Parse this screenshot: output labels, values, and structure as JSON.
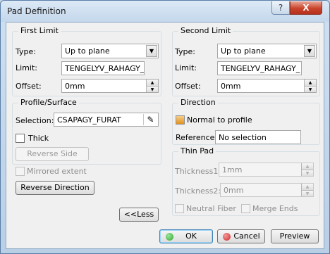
{
  "window": {
    "title": "Pad Definition",
    "help_label": "?",
    "close_label": "X"
  },
  "first_limit": {
    "legend": "First Limit",
    "type_label": "Type:",
    "type_value": "Up to plane",
    "limit_label": "Limit:",
    "limit_value": "TENGELYV_RAHAGY_",
    "offset_label": "Offset:",
    "offset_value": "0mm"
  },
  "profile": {
    "legend": "Profile/Surface",
    "selection_label": "Selection:",
    "selection_value": "CSAPAGY_FURAT",
    "thick_label": "Thick",
    "reverse_side_label": "Reverse Side"
  },
  "mirrored_extent_label": "Mirrored extent",
  "reverse_direction_label": "Reverse Direction",
  "less_label": "<<Less",
  "second_limit": {
    "legend": "Second Limit",
    "type_label": "Type:",
    "type_value": "Up to plane",
    "limit_label": "Limit:",
    "limit_value": "TENGELYV_RAHAGY_",
    "offset_label": "Offset:",
    "offset_value": "0mm"
  },
  "direction": {
    "legend": "Direction",
    "normal_label": "Normal to profile",
    "reference_label": "Reference:",
    "reference_value": "No selection"
  },
  "thin_pad": {
    "legend": "Thin Pad",
    "thickness1_label": "Thickness1",
    "thickness1_value": "1mm",
    "thickness2_label": "Thickness2:",
    "thickness2_value": "0mm",
    "neutral_fiber_label": "Neutral Fiber",
    "merge_ends_label": "Merge Ends"
  },
  "footer": {
    "ok_label": "OK",
    "cancel_label": "Cancel",
    "preview_label": "Preview"
  },
  "colors": {
    "ok_icon": "#2fa82f",
    "cancel_icon": "#d12a2a",
    "close_button": "#c9432b"
  }
}
